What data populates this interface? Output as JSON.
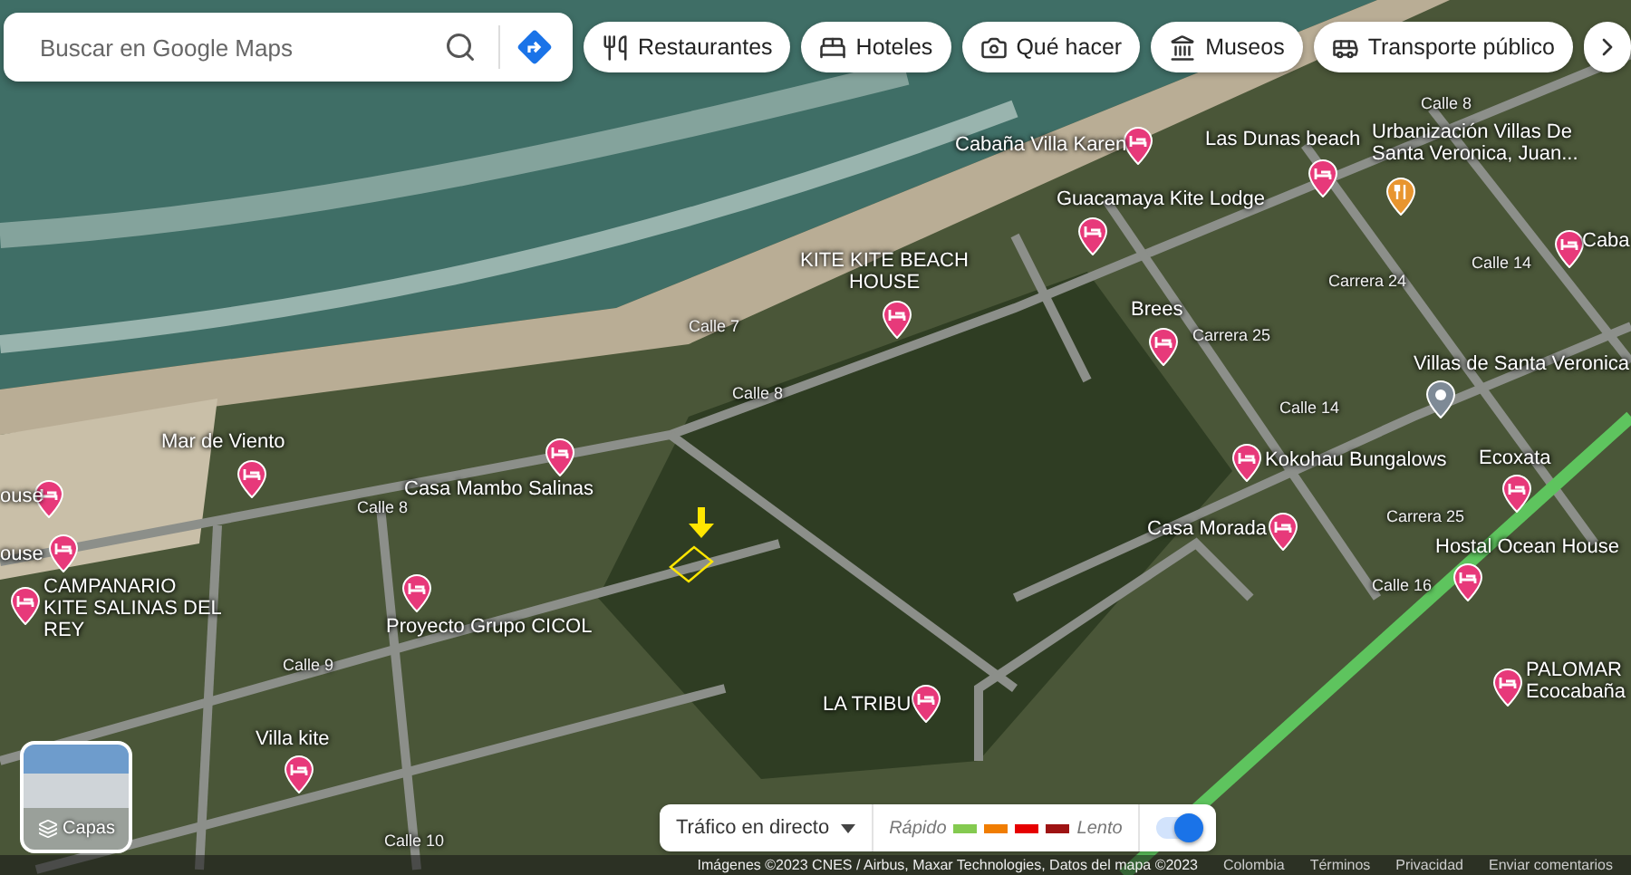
{
  "search": {
    "placeholder": "Buscar en Google Maps"
  },
  "chips": [
    {
      "label": "Restaurantes",
      "kind": "restaurant"
    },
    {
      "label": "Hoteles",
      "kind": "hotel"
    },
    {
      "label": "Qué hacer",
      "kind": "camera"
    },
    {
      "label": "Museos",
      "kind": "museum"
    },
    {
      "label": "Transporte público",
      "kind": "transit"
    }
  ],
  "places": [
    {
      "name": "Cabaña Villa Karen",
      "kind": "hotel"
    },
    {
      "name": "Las Dunas beach",
      "kind": "hotel"
    },
    {
      "name": "Urbanización Villas De Santa Veronica, Juan...",
      "kind": "restaurant"
    },
    {
      "name": "Guacamaya Kite Lodge",
      "kind": "hotel"
    },
    {
      "name": "KITE KITE BEACH HOUSE",
      "kind": "hotel"
    },
    {
      "name": "Brees",
      "kind": "hotel"
    },
    {
      "name": "Caba",
      "kind": "hotel"
    },
    {
      "name": "Villas de Santa Veronica",
      "kind": "place"
    },
    {
      "name": "Mar de Viento",
      "kind": "hotel"
    },
    {
      "name": "Casa Mambo Salinas",
      "kind": "hotel"
    },
    {
      "name": "ouse",
      "kind": "hotel"
    },
    {
      "name": "ouse",
      "kind": "hotel"
    },
    {
      "name": "CAMPANARIO KITE SALINAS DEL REY",
      "kind": "hotel"
    },
    {
      "name": "Proyecto Grupo CICOL",
      "kind": "hotel"
    },
    {
      "name": "Villa kite",
      "kind": "hotel"
    },
    {
      "name": "Kokohau Bungalows",
      "kind": "hotel"
    },
    {
      "name": "Ecoxata",
      "kind": "hotel"
    },
    {
      "name": "Casa Morada",
      "kind": "hotel"
    },
    {
      "name": "Hostal Ocean House",
      "kind": "hotel"
    },
    {
      "name": "PALOMAR Ecocabaña",
      "kind": "hotel"
    },
    {
      "name": "LA TRIBU",
      "kind": "hotel"
    }
  ],
  "streets": [
    "Calle 8",
    "Carrera 24",
    "Calle 14",
    "Carrera 25",
    "Calle 14",
    "Calle 7",
    "Calle 8",
    "Calle 8",
    "Calle 9",
    "Calle 10",
    "Carrera 25",
    "Calle 16"
  ],
  "layers": {
    "label": "Capas"
  },
  "traffic": {
    "label": "Tráfico en directo",
    "fast": "Rápido",
    "slow": "Lento",
    "on": true,
    "legend": [
      {
        "color": "#84ca50"
      },
      {
        "color": "#f07d02"
      },
      {
        "color": "#e60000"
      },
      {
        "color": "#9e1313"
      }
    ]
  },
  "attribution": {
    "imagery": "Imágenes ©2023 CNES / Airbus, Maxar Technologies, Datos del mapa ©2023",
    "links": [
      "Colombia",
      "Términos",
      "Privacidad",
      "Enviar comentarios"
    ]
  }
}
